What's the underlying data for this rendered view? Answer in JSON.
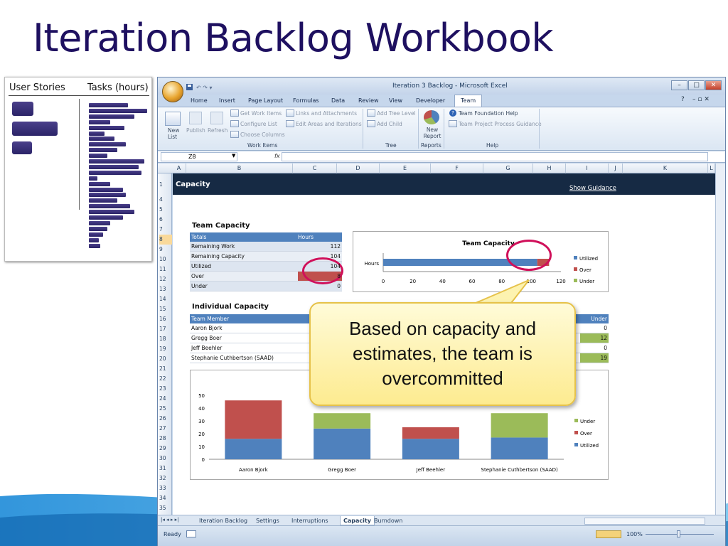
{
  "slide": {
    "title": "Iteration Backlog Workbook",
    "callout": "Based on capacity and estimates, the team is overcommitted"
  },
  "left_panel": {
    "col1_header": "User Stories",
    "col2_header": "Tasks (hours)"
  },
  "excel": {
    "window_title": "Iteration 3 Backlog - Microsoft Excel",
    "tabs": [
      "Home",
      "Insert",
      "Page Layout",
      "Formulas",
      "Data",
      "Review",
      "View",
      "Developer",
      "Team"
    ],
    "ribbon": {
      "new_list": "New List",
      "publish": "Publish",
      "refresh": "Refresh",
      "get_work_items": "Get Work Items",
      "configure_list": "Configure List",
      "choose_columns": "Choose Columns",
      "links_attachments": "Links and Attachments",
      "edit_areas": "Edit Areas and Iterations",
      "work_items_group": "Work Items",
      "add_tree_level": "Add Tree Level",
      "add_child": "Add Child",
      "tree_group": "Tree",
      "new_report": "New Report",
      "reports_group": "Reports",
      "tf_help": "Team Foundation Help",
      "tp_guidance": "Team Project Process Guidance",
      "help_group": "Help"
    },
    "name_box": "Z8",
    "fx": "fx",
    "columns": [
      "A",
      "B",
      "C",
      "D",
      "E",
      "F",
      "G",
      "H",
      "I",
      "J",
      "K",
      "L"
    ],
    "rows": [
      "1",
      "4",
      "5",
      "6",
      "7",
      "8",
      "9",
      "10",
      "11",
      "12",
      "13",
      "14",
      "15",
      "16",
      "17",
      "18",
      "19",
      "20",
      "21",
      "22",
      "23",
      "24",
      "25",
      "26",
      "27",
      "28",
      "29",
      "30",
      "31",
      "32",
      "33",
      "34",
      "35"
    ],
    "sheet_title": "Capacity",
    "show_guidance": "Show Guidance",
    "team_capacity_heading": "Team Capacity",
    "team_table": {
      "headers": [
        "Totals",
        "Hours"
      ],
      "rows": [
        {
          "label": "Remaining Work",
          "value": "112"
        },
        {
          "label": "Remaining Capacity",
          "value": "104"
        },
        {
          "label": "Utilized",
          "value": "104"
        },
        {
          "label": "Over",
          "value": "8"
        },
        {
          "label": "Under",
          "value": "0"
        }
      ]
    },
    "individual_heading": "Individual Capacity",
    "individual_table": {
      "headers": [
        "Team Member",
        "Under"
      ],
      "rows": [
        {
          "name": "Aaron Bjork",
          "under": "0"
        },
        {
          "name": "Gregg Boer",
          "under": "12"
        },
        {
          "name": "Jeff Beehler",
          "under": "0"
        },
        {
          "name": "Stephanie Cuthbertson (SAAD)",
          "under": "19"
        }
      ]
    },
    "sheet_tabs": [
      "Iteration Backlog",
      "Settings",
      "Interruptions",
      "Capacity",
      "Burndown"
    ],
    "status": "Ready",
    "zoom": "100%"
  },
  "chart_data": [
    {
      "type": "bar",
      "orientation": "horizontal",
      "stacked": true,
      "title": "Team Capacity",
      "categories": [
        "Hours"
      ],
      "series": [
        {
          "name": "Utilized",
          "values": [
            104
          ],
          "color": "#4f81bd"
        },
        {
          "name": "Over",
          "values": [
            8
          ],
          "color": "#c0504d"
        },
        {
          "name": "Under",
          "values": [
            0
          ],
          "color": "#9bbb59"
        }
      ],
      "xlim": [
        0,
        120
      ],
      "xticks": [
        "0",
        "20",
        "40",
        "60",
        "80",
        "100",
        "120"
      ],
      "legend": "right"
    },
    {
      "type": "bar",
      "stacked": true,
      "categories": [
        "Aaron Bjork",
        "Gregg Boer",
        "Jeff Beehler",
        "Stephanie Cuthbertson (SAAD)"
      ],
      "series": [
        {
          "name": "Utilized",
          "values": [
            16,
            24,
            16,
            17
          ],
          "color": "#4f81bd"
        },
        {
          "name": "Over",
          "values": [
            30,
            0,
            9,
            0
          ],
          "color": "#c0504d"
        },
        {
          "name": "Under",
          "values": [
            0,
            12,
            0,
            19
          ],
          "color": "#9bbb59"
        }
      ],
      "ylim": [
        0,
        50
      ],
      "yticks": [
        "0",
        "10",
        "20",
        "30",
        "40",
        "50"
      ],
      "legend": "right"
    }
  ]
}
